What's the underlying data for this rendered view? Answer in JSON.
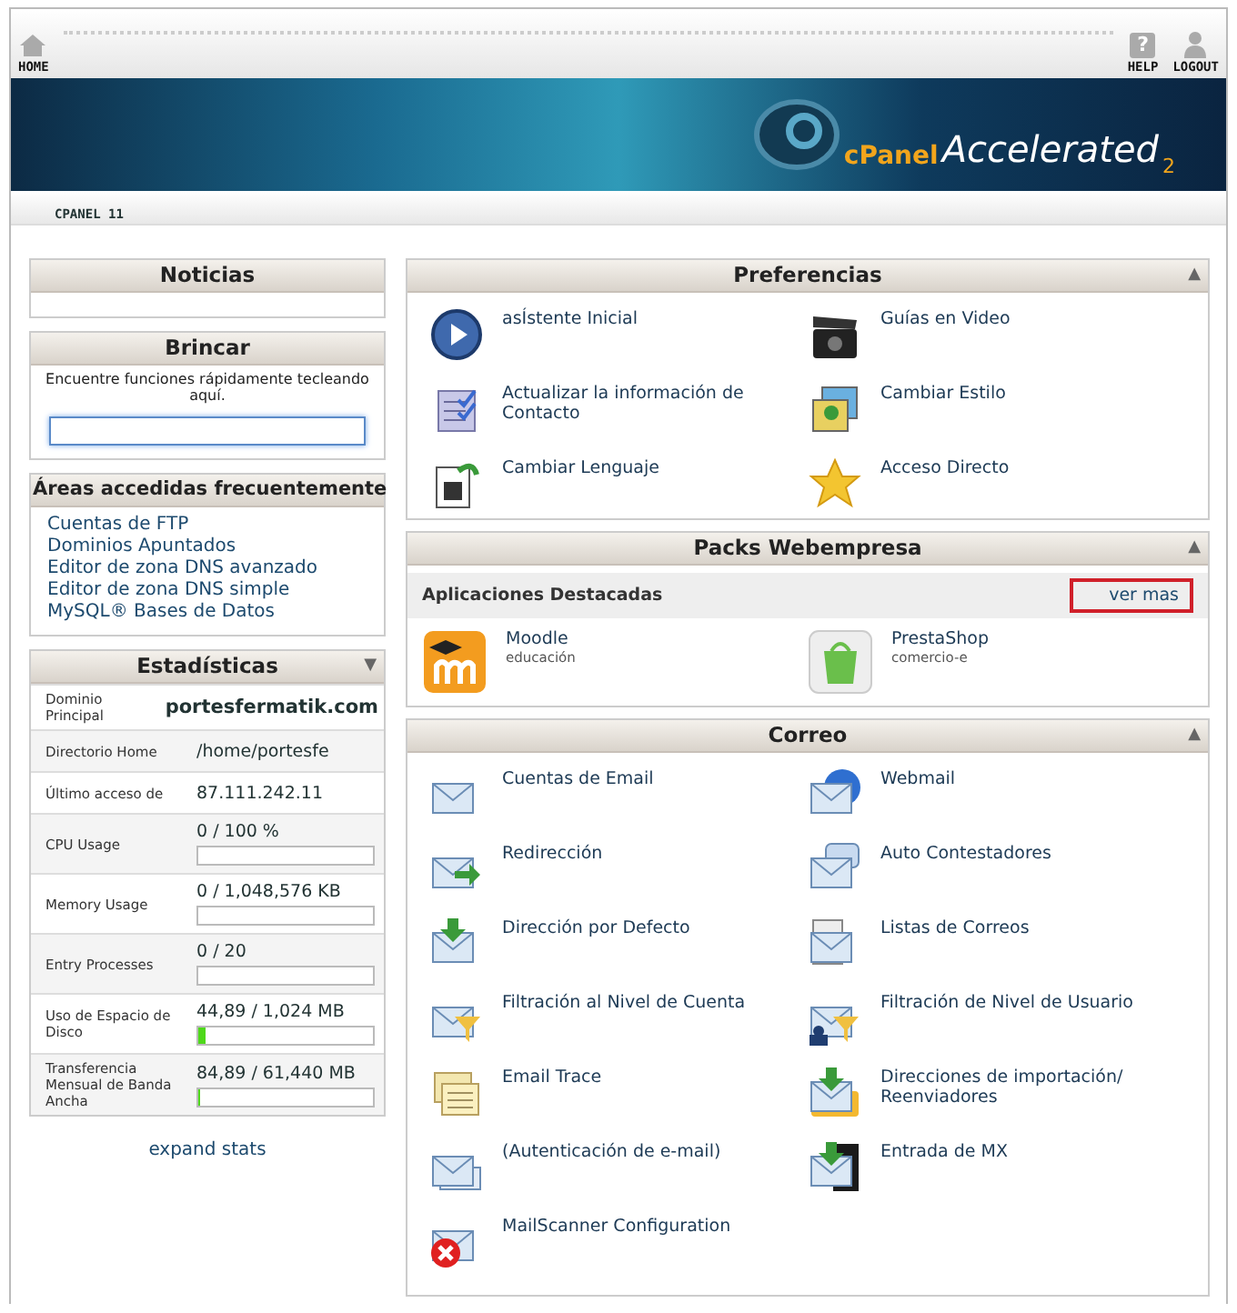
{
  "header": {
    "home": {
      "label": "HOME"
    },
    "help": {
      "label": "HELP",
      "glyph": "?"
    },
    "logout": {
      "label": "LOGOUT"
    }
  },
  "banner": {
    "logo_prefix": "cPanel",
    "logo_name": "Accelerated",
    "logo_suffix": "2"
  },
  "breadcrumb": "CPANEL 11",
  "news": {
    "title": "Noticias"
  },
  "jump": {
    "title": "Brincar",
    "description": "Encuentre funciones rápidamente tecleando aquí."
  },
  "frequent": {
    "title": "Áreas accedidas frecuentemente",
    "links": [
      "Cuentas de FTP",
      "Dominios Apuntados",
      "Editor de zona DNS avanzado",
      "Editor de zona DNS simple",
      "MySQL® Bases de Datos"
    ]
  },
  "stats": {
    "title": "Estadísticas",
    "toggle": "▼",
    "rows": [
      {
        "kind": "bold",
        "label": "Dominio Principal",
        "value": "portesfermatik.com"
      },
      {
        "kind": "text",
        "label": "Directorio Home",
        "value": "/home/portesfe"
      },
      {
        "kind": "text",
        "label": "Último acceso de",
        "value": "87.111.242.11"
      },
      {
        "kind": "bar",
        "label": "CPU Usage",
        "value": "0 / 100 %"
      },
      {
        "kind": "bar",
        "label": "Memory Usage",
        "value": "0 / 1,048,576 KB"
      },
      {
        "kind": "bar",
        "label": "Entry Processes",
        "value": "0 / 20"
      },
      {
        "kind": "bar",
        "label": "Uso de Espacio de Disco",
        "value": "44,89 / 1,024 MB",
        "level": 0.044
      },
      {
        "kind": "bar",
        "label": "Transferencia Mensual de Banda Ancha",
        "value": "84,89 / 61,440 MB",
        "level": 0.001
      }
    ]
  },
  "expand_link": "expand stats",
  "preferences": {
    "title": "Preferencias",
    "toggle": "▲",
    "items": [
      "asÍstente Inicial",
      "Guías en Video",
      "Actualizar la información de Contacto",
      "Cambiar Estilo",
      "Cambiar Lenguaje",
      "Acceso Directo"
    ]
  },
  "packs": {
    "title": "Packs Webempresa",
    "toggle": "▲",
    "subheader": "Aplicaciones Destacadas",
    "more_link": {
      "label": "ver mas",
      "highlighted": true
    },
    "apps": [
      {
        "name": "Moodle",
        "category": "educación"
      },
      {
        "name": "PrestaShop",
        "category": "comercio-e"
      }
    ]
  },
  "mail": {
    "title": "Correo",
    "toggle": "▲",
    "items": [
      "Cuentas de Email",
      "Webmail",
      "Redirección",
      "Auto Contestadores",
      "Dirección por Defecto",
      "Listas de Correos",
      "Filtración al Nivel de Cuenta",
      "Filtración de Nivel de Usuario",
      "Email Trace",
      "Direcciones de importación/ Reenviadores",
      "(Autenticación de e-mail)",
      "Entrada de MX",
      "MailScanner Configuration"
    ]
  }
}
